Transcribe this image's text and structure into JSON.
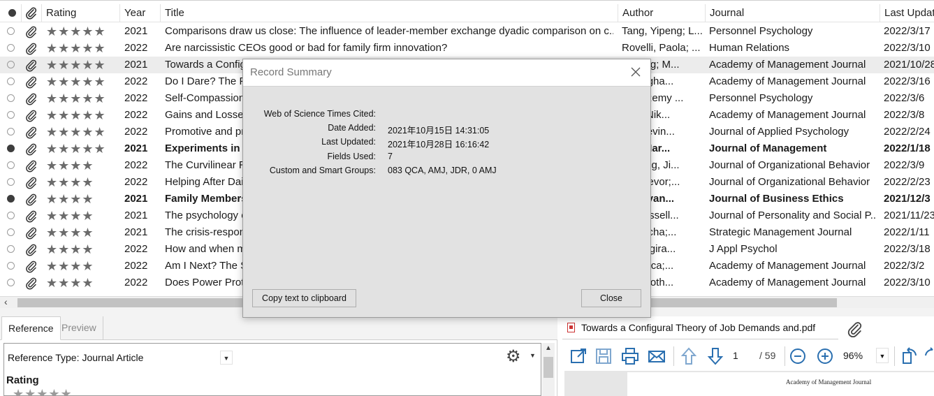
{
  "table": {
    "columns": {
      "read_status": "",
      "attachment": "",
      "rating": "Rating",
      "year": "Year",
      "title": "Title",
      "author": "Author",
      "journal": "Journal",
      "last_updated": "Last Updat"
    },
    "rows": [
      {
        "unread": false,
        "bold": false,
        "selected": false,
        "stars": "★★★★★",
        "year": "2021",
        "title": "Comparisons draw us close: The influence of leader-member exchange dyadic comparison on c...",
        "author": "Tang, Yipeng; L...",
        "journal": "Personnel Psychology",
        "updated": "2022/3/17"
      },
      {
        "unread": false,
        "bold": false,
        "selected": false,
        "stars": "★★★★★",
        "year": "2022",
        "title": "Are narcissistic CEOs good or bad for family firm innovation?",
        "author": "Rovelli, Paola; ...",
        "journal": "Human Relations",
        "updated": "2022/3/10"
      },
      {
        "unread": false,
        "bold": false,
        "selected": true,
        "stars": "★★★★★",
        "year": "2021",
        "title": "Towards a Configural Theory of Job Demands and Resources",
        "author": "ee Ong; M...",
        "journal": "Academy of Management Journal",
        "updated": "2021/10/28"
      },
      {
        "unread": false,
        "bold": false,
        "selected": false,
        "stars": "★★★★★",
        "year": "2022",
        "title": "Do I Dare? The Psychological",
        "author": "unningha...",
        "journal": "Academy of Management Journal",
        "updated": "2022/3/16"
      },
      {
        "unread": false,
        "bold": false,
        "selected": false,
        "stars": "★★★★★",
        "year": "2022",
        "title": "Self-Compassion at Work",
        "author": "ngs, Remy ...",
        "journal": "Personnel Psychology",
        "updated": "2022/3/6"
      },
      {
        "unread": false,
        "bold": false,
        "selected": false,
        "stars": "★★★★★",
        "year": "2022",
        "title": "Gains and Losses of Status",
        "author": "akis, Nik...",
        "journal": "Academy of Management Journal",
        "updated": "2022/3/8"
      },
      {
        "unread": false,
        "bold": false,
        "selected": false,
        "stars": "★★★★★",
        "year": "2022",
        "title": "Promotive and prohibitive voice",
        "author": "A.; Trevin...",
        "journal": "Journal of Applied Psychology",
        "updated": "2022/2/24"
      },
      {
        "unread": true,
        "bold": true,
        "selected": false,
        "stars": "★★★★★",
        "year": "2021",
        "title": "Experiments in Strategy",
        "author": "ger, Mar...",
        "journal": "Journal of Management",
        "updated": "2022/1/18"
      },
      {
        "unread": false,
        "bold": false,
        "selected": false,
        "stars": "★★★★",
        "year": "2022",
        "title": "The Curvilinear Relationship",
        "author": "n; Feng, Ji...",
        "journal": "Journal of Organizational Behavior",
        "updated": "2022/3/9"
      },
      {
        "unread": false,
        "bold": false,
        "selected": false,
        "stars": "★★★★",
        "year": "2022",
        "title": "Helping After Daily Work",
        "author": "ns, Trevor;...",
        "journal": "Journal of Organizational Behavior",
        "updated": "2022/2/23"
      },
      {
        "unread": true,
        "bold": true,
        "selected": false,
        "stars": "★★★★",
        "year": "2021",
        "title": "Family Members' Ethics",
        "author": "ri, Silvan...",
        "journal": "Journal of Business Ethics",
        "updated": "2021/12/3"
      },
      {
        "unread": false,
        "bold": false,
        "selected": false,
        "stars": "★★★★",
        "year": "2021",
        "title": "The psychology of work",
        "author": "ts, Russell...",
        "journal": "Journal of Personality and Social P...",
        "updated": "2021/11/23"
      },
      {
        "unread": false,
        "bold": false,
        "selected": false,
        "stars": "★★★★",
        "year": "2021",
        "title": "The crisis-response",
        "author": "l, Sascha;...",
        "journal": "Strategic Management Journal",
        "updated": "2022/1/11"
      },
      {
        "unread": false,
        "bold": false,
        "selected": false,
        "stars": "★★★★",
        "year": "2022",
        "title": "How and when managers",
        "author": "l.; Tangira...",
        "journal": "J Appl Psychol",
        "updated": "2022/3/18"
      },
      {
        "unread": false,
        "bold": false,
        "selected": false,
        "stars": "★★★★",
        "year": "2022",
        "title": "Am I Next? The Spillover",
        "author": "Angelica;...",
        "journal": "Academy of Management Journal",
        "updated": "2022/3/2"
      },
      {
        "unread": false,
        "bold": false,
        "selected": false,
        "stars": "★★★★",
        "year": "2022",
        "title": "Does Power Protect",
        "author": "o, Timoth...",
        "journal": "Academy of Management Journal",
        "updated": "2022/3/10"
      }
    ]
  },
  "left_pane": {
    "tabs": [
      "Reference",
      "Preview"
    ],
    "reference_type_label": "Reference Type:",
    "reference_type_value": "Journal Article",
    "rating_label": "Rating",
    "rating_stars": "★★★★★"
  },
  "right_pane": {
    "pdf_name": "Towards a Configural Theory of Job Demands and.pdf",
    "page_current": "1",
    "page_total": "/ 59",
    "zoom": "96%",
    "pdf_page_header": "Academy of Management Journal"
  },
  "dialog": {
    "title": "Record Summary",
    "fields": [
      {
        "key": "Web of Science Times Cited:",
        "value": ""
      },
      {
        "key": "Date Added:",
        "value": "2021年10月15日 14:31:05"
      },
      {
        "key": "Last Updated:",
        "value": "2021年10月28日 16:16:42"
      },
      {
        "key": "Fields Used:",
        "value": "7"
      },
      {
        "key": "Custom and Smart Groups:",
        "value": "083 QCA, AMJ, JDR, 0 AMJ"
      }
    ],
    "copy_button": "Copy text to clipboard",
    "close_button": "Close"
  },
  "colors": {
    "selected_row": "#ececec",
    "dialog_body": "#e2e2e2",
    "star": "#6b6b6b"
  }
}
